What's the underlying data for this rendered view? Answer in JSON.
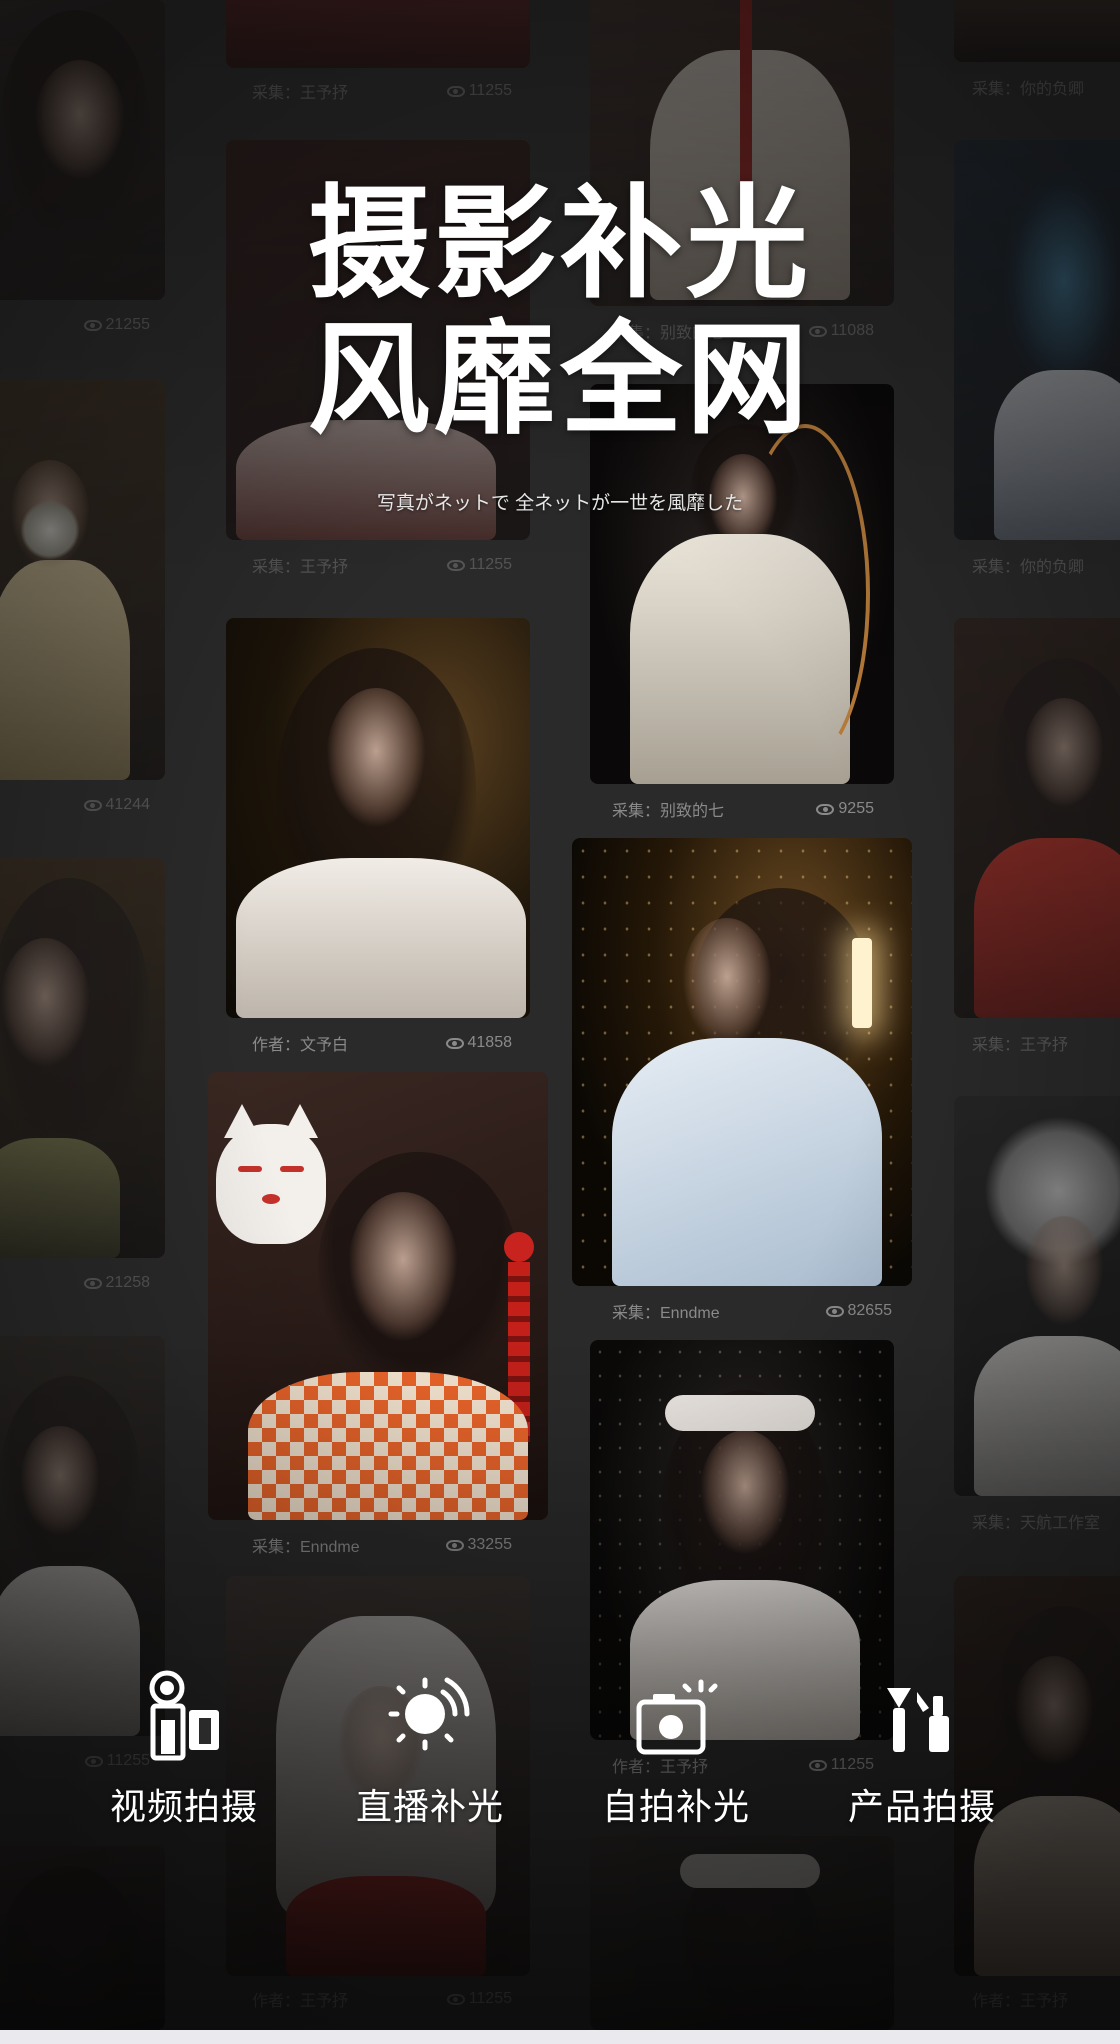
{
  "headline": {
    "line1": "摄影补光",
    "line2": "风靡全网"
  },
  "subtitle": "写真がネットで  全ネットが一世を風靡した",
  "cards": [
    {
      "author": "采集：王予抒",
      "views": "11255"
    },
    {
      "author": "采集：你的负卿",
      "views": ""
    },
    {
      "author": "",
      "views": "21255"
    },
    {
      "author": "采集：别致的七",
      "views": "11088"
    },
    {
      "author": "采集：王予抒",
      "views": "11255"
    },
    {
      "author": "采集：你的负卿",
      "views": ""
    },
    {
      "author": "",
      "views": "41244"
    },
    {
      "author": "采集：别致的七",
      "views": "9255"
    },
    {
      "author": "作者：文予白",
      "views": "41858"
    },
    {
      "author": "采集：王予抒",
      "views": ""
    },
    {
      "author": "采集：Enndme",
      "views": "82655"
    },
    {
      "author": "",
      "views": "21258"
    },
    {
      "author": "采集：Enndme",
      "views": "33255"
    },
    {
      "author": "采集：天航工作室",
      "views": ""
    },
    {
      "author": "",
      "views": "11255"
    },
    {
      "author": "作者：王予抒",
      "views": "11255"
    },
    {
      "author": "作者：王予抒",
      "views": "11255"
    },
    {
      "author": "作者：王予抒",
      "views": ""
    }
  ],
  "features": [
    {
      "label": "视频拍摄",
      "icon": "video-camera-icon"
    },
    {
      "label": "直播补光",
      "icon": "ring-light-icon"
    },
    {
      "label": "自拍补光",
      "icon": "selfie-camera-icon"
    },
    {
      "label": "产品拍摄",
      "icon": "product-icon"
    }
  ]
}
